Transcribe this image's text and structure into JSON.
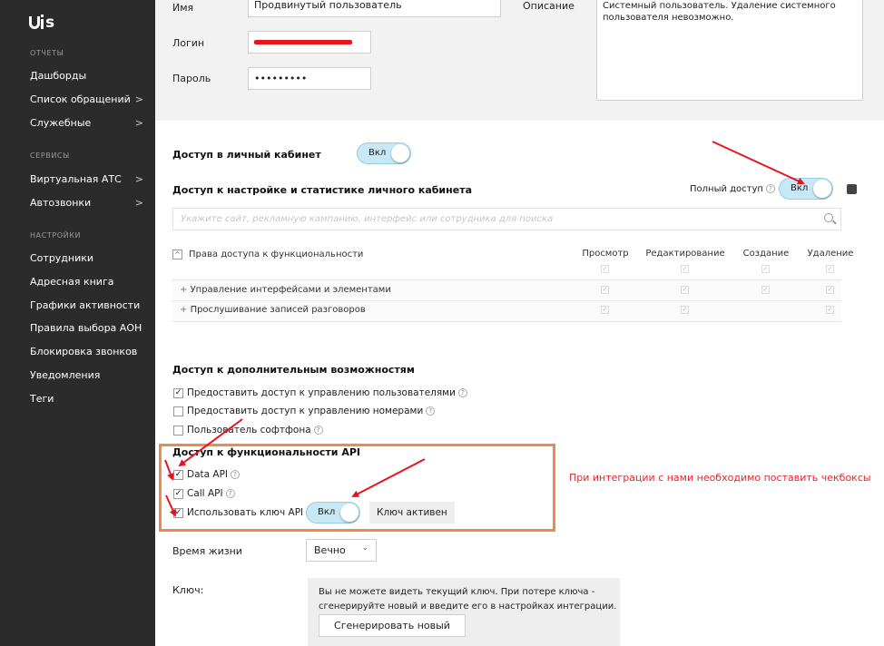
{
  "sidebar": {
    "logo_text": "UIS",
    "sections": [
      {
        "title": "ОТЧЕТЫ",
        "items": [
          {
            "label": "Дашборды",
            "chevron": ""
          },
          {
            "label": "Список обращений",
            "chevron": ">"
          },
          {
            "label": "Служебные",
            "chevron": ">"
          }
        ]
      },
      {
        "title": "СЕРВИСЫ",
        "items": [
          {
            "label": "Виртуальная АТС",
            "chevron": ">"
          },
          {
            "label": "Автозвонки",
            "chevron": ">"
          }
        ]
      },
      {
        "title": "НАСТРОЙКИ",
        "items": [
          {
            "label": "Сотрудники",
            "chevron": ""
          },
          {
            "label": "Адресная книга",
            "chevron": ""
          },
          {
            "label": "Графики активности",
            "chevron": ""
          },
          {
            "label": "Правила выбора АОН",
            "chevron": ""
          },
          {
            "label": "Блокировка звонков",
            "chevron": ""
          },
          {
            "label": "Уведомления",
            "chevron": ""
          },
          {
            "label": "Теги",
            "chevron": ""
          }
        ]
      }
    ]
  },
  "form": {
    "name_label": "Имя",
    "name_value": "Продвинутый пользователь",
    "login_label": "Логин",
    "password_label": "Пароль",
    "password_value": "•••••••••",
    "description_label": "Описание",
    "description_value": "Системный пользователь. Удаление системного пользователя невозможно."
  },
  "cabinet": {
    "access_title": "Доступ в личный кабинет",
    "access_toggle": "Вкл",
    "settings_title": "Доступ к настройке и статистике личного кабинета",
    "full_access_label": "Полный доступ",
    "full_access_toggle": "Вкл",
    "search_placeholder": "Укажите сайт, рекламную кампанию, интерфейс или сотрудника для поиска"
  },
  "permissions": {
    "header": "Права доступа к функциональности",
    "columns": [
      "Просмотр",
      "Редактирование",
      "Создание",
      "Удаление"
    ],
    "rows": [
      {
        "label": "Управление интерфейсами и элементами"
      },
      {
        "label": "Прослушивание записей разговоров"
      }
    ]
  },
  "extra": {
    "title": "Доступ к дополнительным возможностям",
    "items": [
      {
        "label": "Предоставить доступ к управлению пользователями",
        "checked": "✓"
      },
      {
        "label": "Предоставить доступ к управлению номерами",
        "checked": ""
      },
      {
        "label": "Пользователь софтфона",
        "checked": ""
      }
    ]
  },
  "api": {
    "title": "Доступ к функциональности API",
    "items": [
      {
        "label": "Data API",
        "checked": "✓"
      },
      {
        "label": "Call API",
        "checked": "✓"
      },
      {
        "label": "Использовать ключ API",
        "checked": "✓"
      }
    ],
    "key_toggle": "Вкл",
    "key_status": "Ключ активен",
    "note": "При интеграции с нами необходимо поставить чекбоксы"
  },
  "lifetime": {
    "label": "Время жизни",
    "value": "Вечно"
  },
  "key": {
    "label": "Ключ:",
    "text": "Вы не можете видеть текущий ключ. При потере ключа - сгенерируйте новый и введите его в настройках интеграции.",
    "generate_button": "Сгенерировать новый"
  },
  "icons": {
    "help": "question-icon",
    "chevron": "chevron-right-icon",
    "search": "search-icon",
    "copy": "copy-icon",
    "annotation_arrow": "red-arrow-icon"
  },
  "colors": {
    "sidebar_bg": "#2b2b2b",
    "toggle_on": "#c7e8f5",
    "annotation": "#e8141d",
    "highlight_box": "#ef8a4c"
  }
}
